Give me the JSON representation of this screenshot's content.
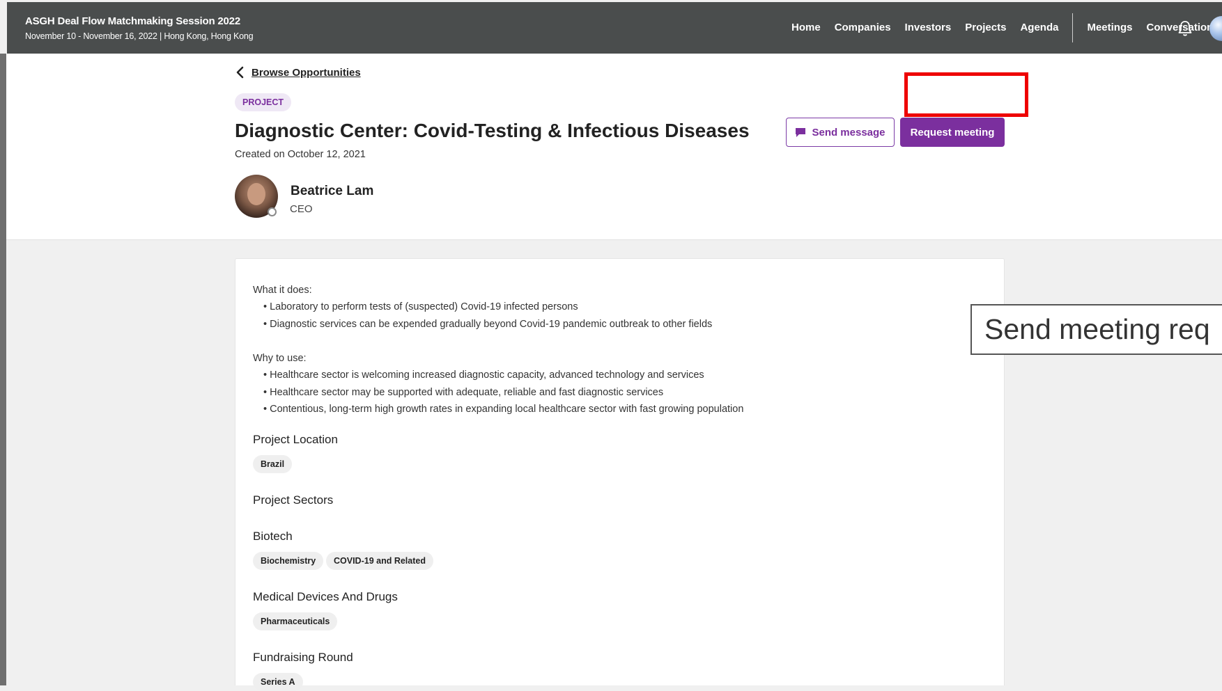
{
  "event": {
    "title": "ASGH Deal Flow Matchmaking Session 2022",
    "subtitle": "November 10 - November 16, 2022 | Hong Kong, Hong Kong"
  },
  "nav": {
    "items": [
      "Home",
      "Companies",
      "Investors",
      "Projects",
      "Agenda"
    ],
    "items_right": [
      "Meetings",
      "Conversations"
    ],
    "bell_icon": "bell-icon",
    "avatar_icon": "globe-avatar-icon"
  },
  "back_link": {
    "label": "Browse Opportunities",
    "icon": "chevron-left-icon"
  },
  "project": {
    "badge": "PROJECT",
    "title": "Diagnostic Center: Covid-Testing & Infectious Diseases",
    "created": "Created on October 12, 2021"
  },
  "owner": {
    "name": "Beatrice Lam",
    "role": "CEO"
  },
  "actions": {
    "send_message": "Send message",
    "send_message_icon": "chat-bubble-icon",
    "request_meeting": "Request meeting"
  },
  "details": {
    "what_label": "What it does:",
    "what_items": [
      "• Laboratory to perform tests of (suspected) Covid-19 infected persons",
      "• Diagnostic services can be expended gradually beyond Covid-19 pandemic outbreak to other fields"
    ],
    "why_label": "Why to use:",
    "why_items": [
      "• Healthcare sector is welcoming increased diagnostic capacity, advanced technology and services",
      "• Healthcare sector may be supported with adequate, reliable and fast diagnostic services",
      "• Contentious, long-term high growth rates in expanding local healthcare sector with fast growing population"
    ],
    "location_heading": "Project Location",
    "location_tags": [
      "Brazil"
    ],
    "sectors_heading": "Project Sectors",
    "sector_groups": [
      {
        "name": "Biotech",
        "tags": [
          "Biochemistry",
          "COVID-19 and Related"
        ]
      },
      {
        "name": "Medical Devices And Drugs",
        "tags": [
          "Pharmaceuticals"
        ]
      }
    ],
    "round_heading": "Fundraising Round",
    "round_tags": [
      "Series A"
    ]
  },
  "tooltip": {
    "text": "Send meeting req"
  },
  "colors": {
    "topbar": "#4a4d4d",
    "accent": "#7b2f9e",
    "highlight": "#ee0000"
  }
}
